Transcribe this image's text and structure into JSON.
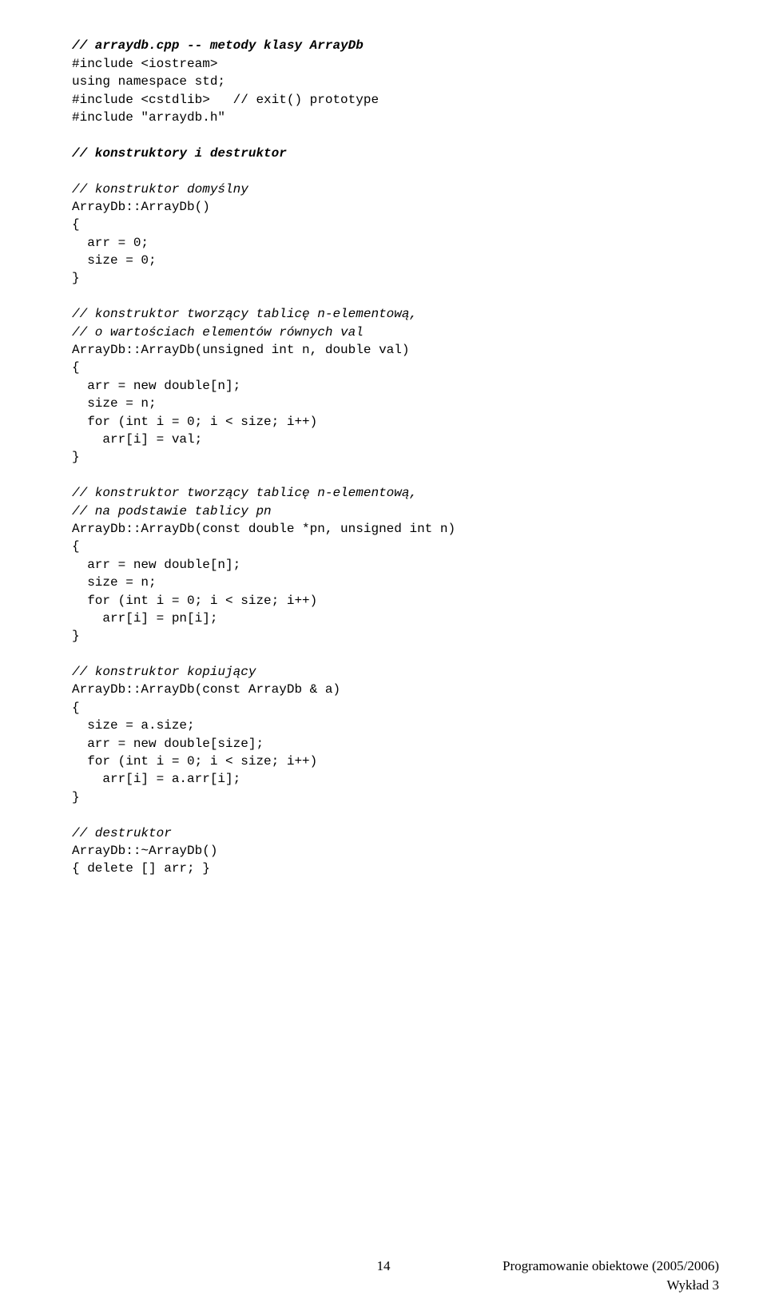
{
  "doc": {
    "line01": "// arraydb.cpp -- metody klasy ArrayDb",
    "line02": "#include <iostream>",
    "line03": "using namespace std;",
    "line04": "#include <cstdlib>   // exit() prototype",
    "line05": "#include \"arraydb.h\"",
    "line06": "// konstruktory i destruktor",
    "line07": "// konstruktor domyślny",
    "line08": "ArrayDb::ArrayDb()",
    "line09": "{",
    "line10": "  arr = 0;",
    "line11": "  size = 0;",
    "line12": "}",
    "line13": "// konstruktor tworzący tablicę n-elementową,",
    "line14": "// o wartościach elementów równych val",
    "line15": "ArrayDb::ArrayDb(unsigned int n, double val)",
    "line16": "{",
    "line17": "  arr = new double[n];",
    "line18": "  size = n;",
    "line19": "  for (int i = 0; i < size; i++)",
    "line20": "    arr[i] = val;",
    "line21": "}",
    "line22": "// konstruktor tworzący tablicę n-elementową,",
    "line23": "// na podstawie tablicy pn",
    "line24": "ArrayDb::ArrayDb(const double *pn, unsigned int n)",
    "line25": "{",
    "line26": "  arr = new double[n];",
    "line27": "  size = n;",
    "line28": "  for (int i = 0; i < size; i++)",
    "line29": "    arr[i] = pn[i];",
    "line30": "}",
    "line31": "// konstruktor kopiujący",
    "line32": "ArrayDb::ArrayDb(const ArrayDb & a)",
    "line33": "{",
    "line34": "  size = a.size;",
    "line35": "  arr = new double[size];",
    "line36": "  for (int i = 0; i < size; i++)",
    "line37": "    arr[i] = a.arr[i];",
    "line38": "}",
    "line39": "// destruktor",
    "line40": "ArrayDb::~ArrayDb()",
    "line41": "{ delete [] arr; }"
  },
  "footer": {
    "page": "14",
    "right1": "Programowanie obiektowe (2005/2006)",
    "right2": "Wykład 3"
  }
}
